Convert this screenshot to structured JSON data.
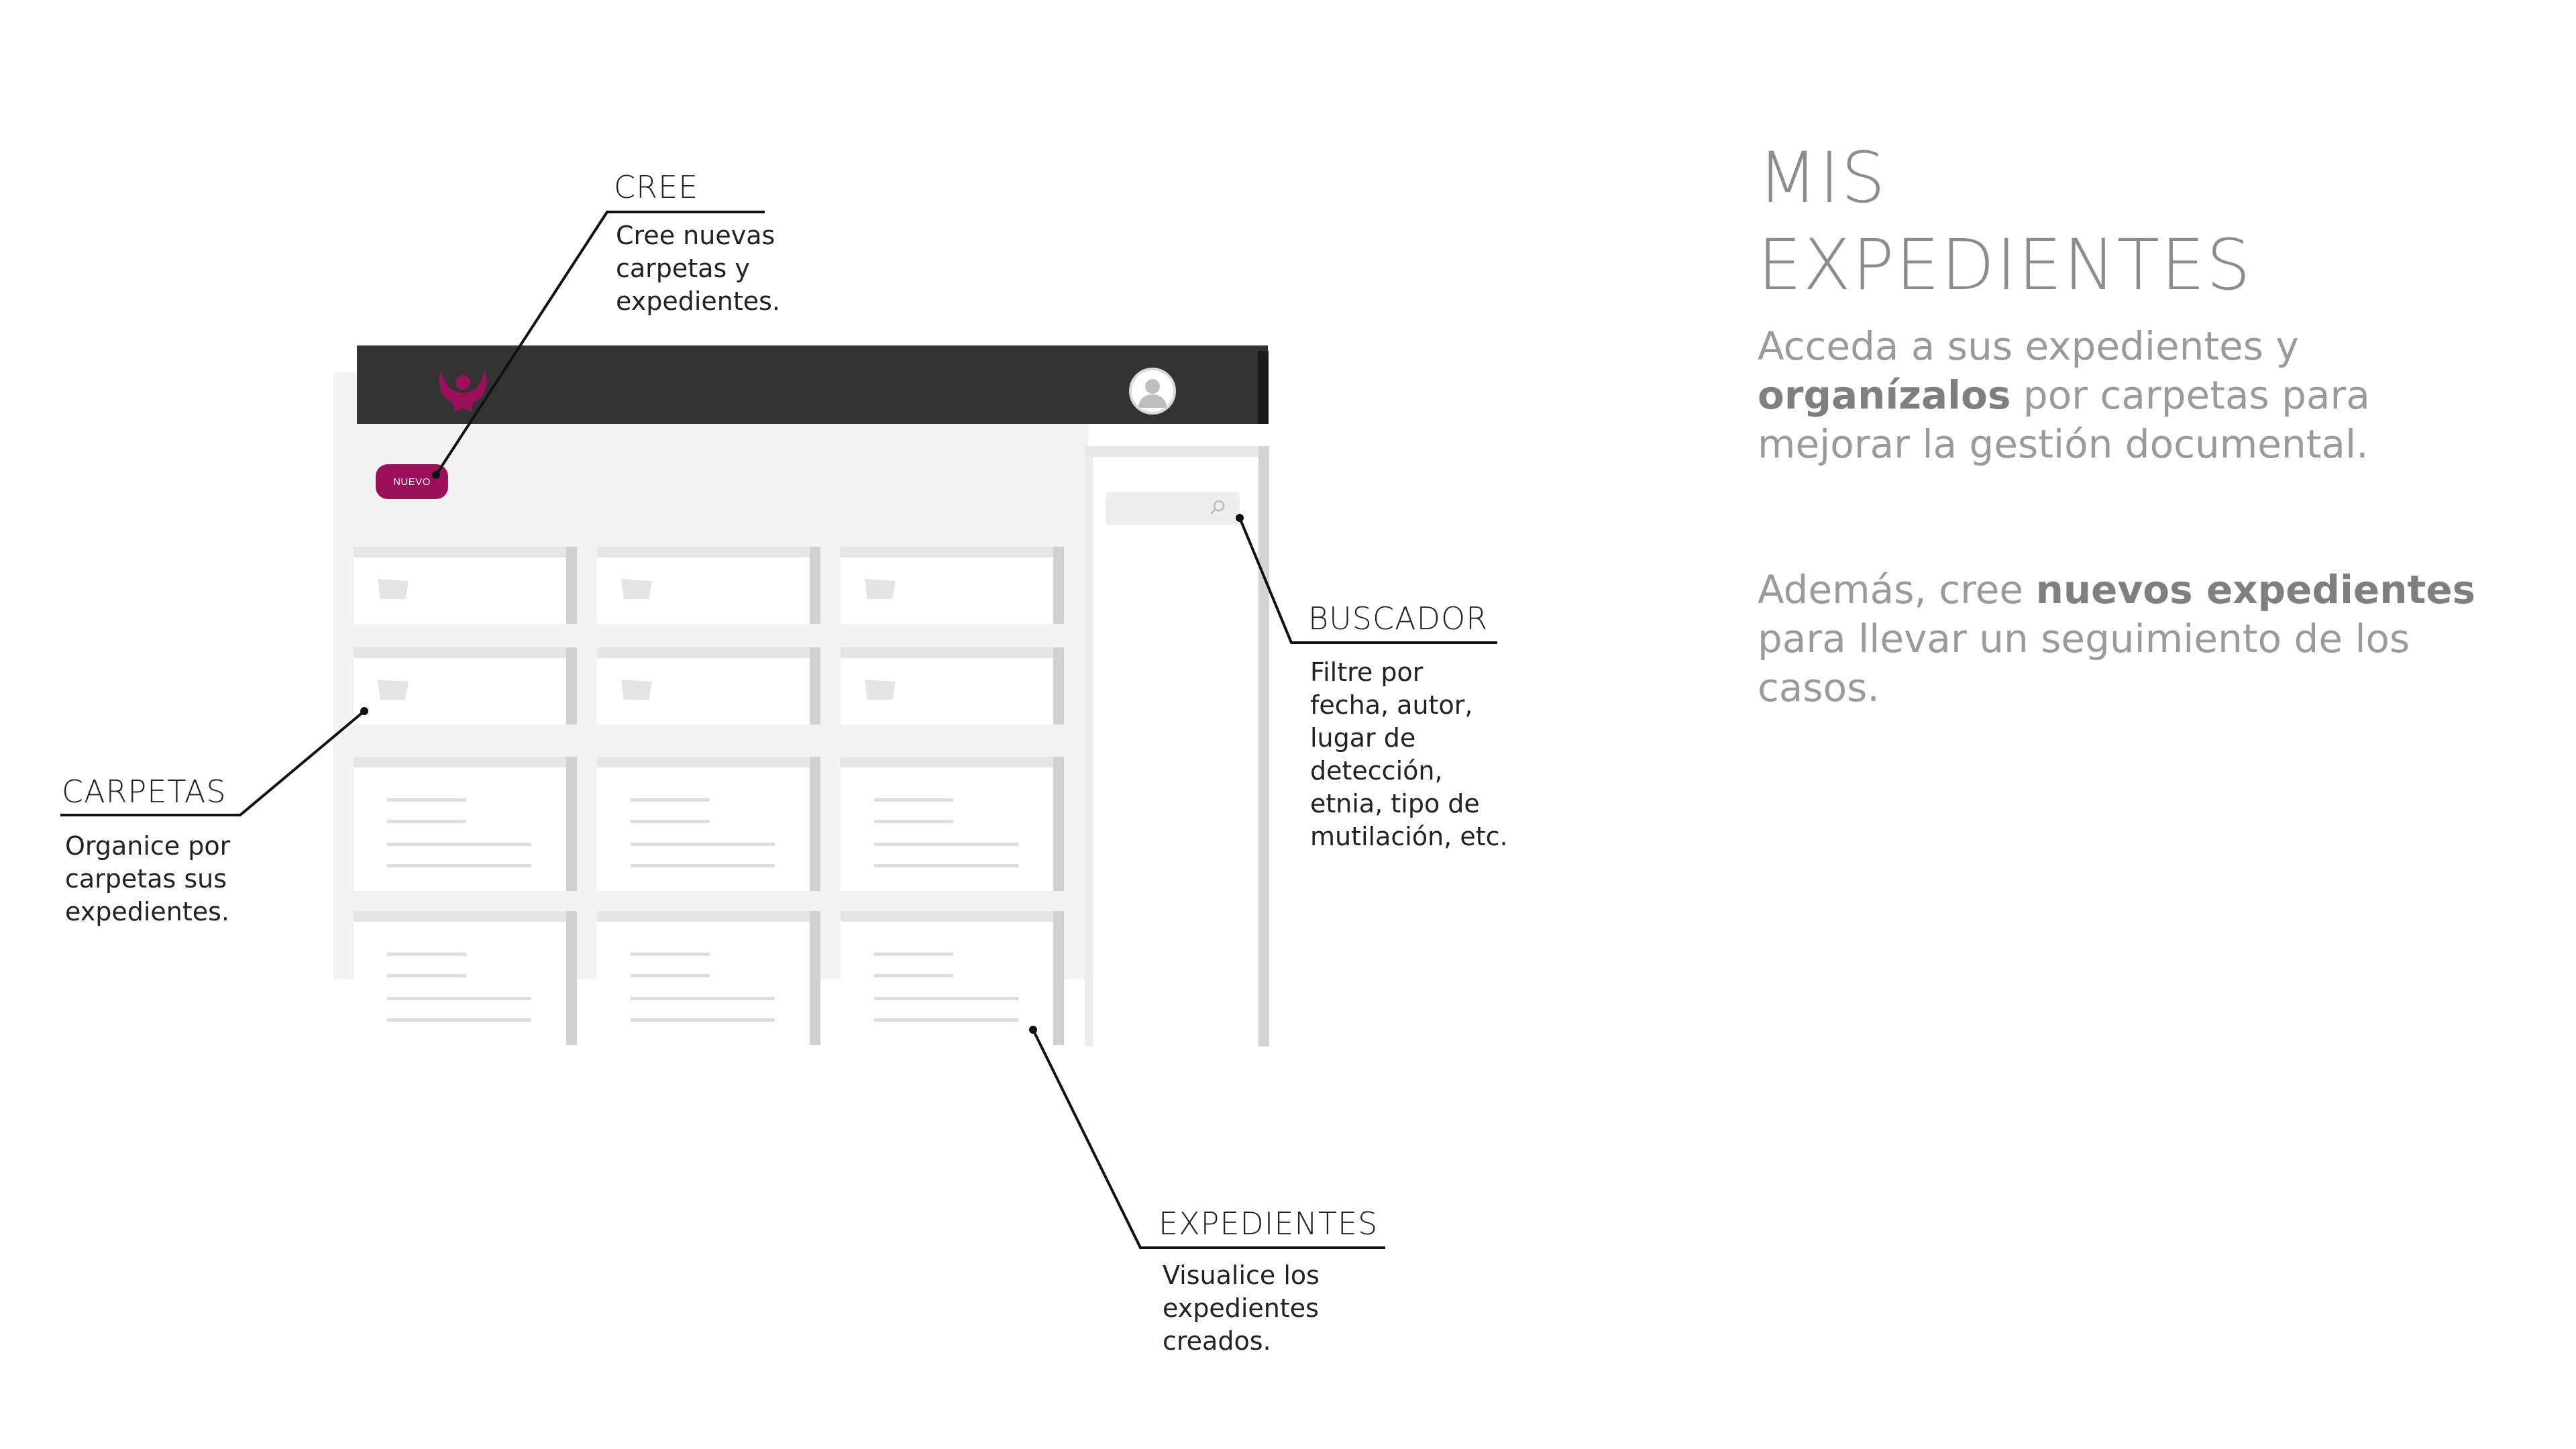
{
  "heading": {
    "line1": "MIS",
    "line2": "EXPEDIENTES"
  },
  "intro": {
    "p1_a": "Acceda a sus expedientes y ",
    "p1_b": "organízalos",
    "p1_c": " por carpetas para mejorar la gestión documental.",
    "p2_a": "Además, cree ",
    "p2_b": "nuevos expedientes",
    "p2_c": " para llevar un seguimiento de los casos."
  },
  "mockup": {
    "new_button": "NUEVO",
    "brand_color": "#9b1159",
    "topbar_color": "#333333"
  },
  "callouts": {
    "cree": {
      "title": "CREE",
      "lines": [
        "Cree nuevas",
        "carpetas y",
        "expedientes."
      ]
    },
    "buscador": {
      "title": "BUSCADOR",
      "lines": [
        "Filtre por",
        "fecha, autor,",
        "lugar de",
        "detección,",
        "etnia, tipo de",
        "mutilación, etc."
      ]
    },
    "carpetas": {
      "title": "CARPETAS",
      "lines": [
        "Organice por",
        "carpetas sus",
        "expedientes."
      ]
    },
    "expedientes": {
      "title": "EXPEDIENTES",
      "lines": [
        "Visualice los",
        "expedientes",
        "creados."
      ]
    }
  }
}
